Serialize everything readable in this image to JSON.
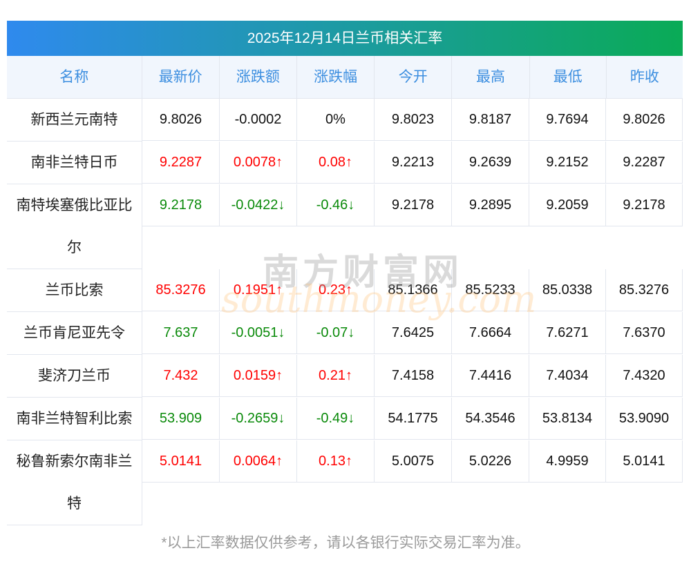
{
  "title": "2025年12月14日兰币相关汇率",
  "headers": [
    "名称",
    "最新价",
    "涨跌额",
    "涨跌幅",
    "今开",
    "最高",
    "最低",
    "昨收"
  ],
  "rows": [
    {
      "name": "新西兰元南特",
      "trend": "flat",
      "latest": "9.8026",
      "change": "-0.0002",
      "pct": "0%",
      "open": "9.8023",
      "high": "9.8187",
      "low": "9.7694",
      "prev": "9.8026"
    },
    {
      "name": "南非兰特日币",
      "trend": "up",
      "latest": "9.2287",
      "change": "0.0078↑",
      "pct": "0.08↑",
      "open": "9.2213",
      "high": "9.2639",
      "low": "9.2152",
      "prev": "9.2287"
    },
    {
      "name": "南特埃塞俄比亚比尔",
      "trend": "down",
      "latest": "9.2178",
      "change": "-0.0422↓",
      "pct": "-0.46↓",
      "open": "9.2178",
      "high": "9.2895",
      "low": "9.2059",
      "prev": "9.2178"
    },
    {
      "name": "兰币比索",
      "trend": "up",
      "latest": "85.3276",
      "change": "0.1951↑",
      "pct": "0.23↑",
      "open": "85.1366",
      "high": "85.5233",
      "low": "85.0338",
      "prev": "85.3276"
    },
    {
      "name": "兰币肯尼亚先令",
      "trend": "down",
      "latest": "7.637",
      "change": "-0.0051↓",
      "pct": "-0.07↓",
      "open": "7.6425",
      "high": "7.6664",
      "low": "7.6271",
      "prev": "7.6370"
    },
    {
      "name": "斐济刀兰币",
      "trend": "up",
      "latest": "7.432",
      "change": "0.0159↑",
      "pct": "0.21↑",
      "open": "7.4158",
      "high": "7.4416",
      "low": "7.4034",
      "prev": "7.4320"
    },
    {
      "name": "南非兰特智利比索",
      "trend": "down",
      "latest": "53.909",
      "change": "-0.2659↓",
      "pct": "-0.49↓",
      "open": "54.1775",
      "high": "54.3546",
      "low": "53.8134",
      "prev": "53.9090"
    },
    {
      "name": "秘鲁新索尔南非兰特",
      "trend": "up",
      "latest": "5.0141",
      "change": "0.0064↑",
      "pct": "0.13↑",
      "open": "5.0075",
      "high": "5.0226",
      "low": "4.9959",
      "prev": "5.0141"
    }
  ],
  "watermark": {
    "cn": "南方财富网",
    "en": "southmoney.com"
  },
  "footer": "*以上汇率数据仅供参考，请以各银行实际交易汇率为准。"
}
